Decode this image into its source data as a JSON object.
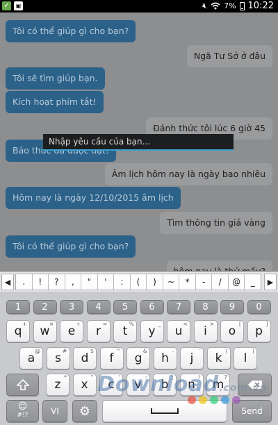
{
  "status_bar": {
    "battery": "7%",
    "time": "10:22",
    "left_icons": [
      "check-icon",
      "bag-icon"
    ],
    "right_icons": [
      "mute-icon",
      "wifi-icon",
      "battery-icon"
    ]
  },
  "messages": [
    {
      "side": "bot",
      "text": "Tôi có thể giúp gì cho bạn?"
    },
    {
      "side": "user",
      "text": "Ngã Tư Sở ở đâu"
    },
    {
      "side": "bot",
      "text": "Tôi sẽ tìm giúp bạn."
    },
    {
      "side": "bot",
      "text": "Kích hoạt phím tắt!"
    },
    {
      "side": "user",
      "text": "Đánh thức tôi lúc 6 giờ 45"
    },
    {
      "side": "bot",
      "text": "Báo thức đã được đặt!"
    },
    {
      "side": "user",
      "text": "Âm lịch hôm nay là ngày bao nhiêu"
    },
    {
      "side": "bot",
      "text": "Hôm nay là ngày 12/10/2015 âm lịch"
    },
    {
      "side": "user",
      "text": "Tìm thông tin giá vàng"
    },
    {
      "side": "bot",
      "text": "Tôi có thể giúp gì cho bạn?"
    },
    {
      "side": "user",
      "text": "hôm nay là thứ mấy?"
    }
  ],
  "input": {
    "placeholder": "Nhập yêu cầu của bạn..."
  },
  "symbol_bar": {
    "left_arrow": "◀",
    "right_arrow": "▶",
    "symbols": [
      ".",
      "!",
      "?",
      ",",
      "\"",
      "'",
      ":",
      "(",
      ")",
      "~",
      "*",
      "-",
      "/",
      "@",
      "_"
    ]
  },
  "keyboard": {
    "numbers": [
      "1",
      "2",
      "3",
      "4",
      "5",
      "6",
      "7",
      "8",
      "9",
      "0"
    ],
    "row1": [
      {
        "k": "q",
        "s": "+"
      },
      {
        "k": "w",
        "s": "×"
      },
      {
        "k": "e",
        "s": "÷"
      },
      {
        "k": "r",
        "s": "="
      },
      {
        "k": "t",
        "s": "%"
      },
      {
        "k": "y",
        "s": "_"
      },
      {
        "k": "u",
        "s": "<"
      },
      {
        "k": "i",
        "s": ">"
      },
      {
        "k": "o",
        "s": "["
      },
      {
        "k": "p",
        "s": "]"
      }
    ],
    "row2": [
      {
        "k": "a",
        "s": "@"
      },
      {
        "k": "s",
        "s": "#"
      },
      {
        "k": "d",
        "s": "$"
      },
      {
        "k": "f",
        "s": "^"
      },
      {
        "k": "g",
        "s": "&"
      },
      {
        "k": "h",
        "s": "-"
      },
      {
        "k": "j",
        "s": "'"
      },
      {
        "k": "k",
        "s": "("
      },
      {
        "k": "l",
        "s": ")"
      }
    ],
    "row3": [
      {
        "k": "z",
        "s": "*"
      },
      {
        "k": "x",
        "s": "\""
      },
      {
        "k": "c",
        "s": "'"
      },
      {
        "k": "v",
        "s": ":"
      },
      {
        "k": "b",
        "s": ";"
      },
      {
        "k": "n",
        "s": "!"
      },
      {
        "k": "m",
        "s": "?"
      }
    ],
    "emoji_label": "#!?",
    "lang_label": "VI",
    "send_label": "Send"
  },
  "watermark": {
    "text": "Download",
    "tld": ".com.vn",
    "dot_colors": [
      "#e84c3d",
      "#f1c40f",
      "#2ecc71",
      "#3498db",
      "#9b59b6"
    ]
  }
}
